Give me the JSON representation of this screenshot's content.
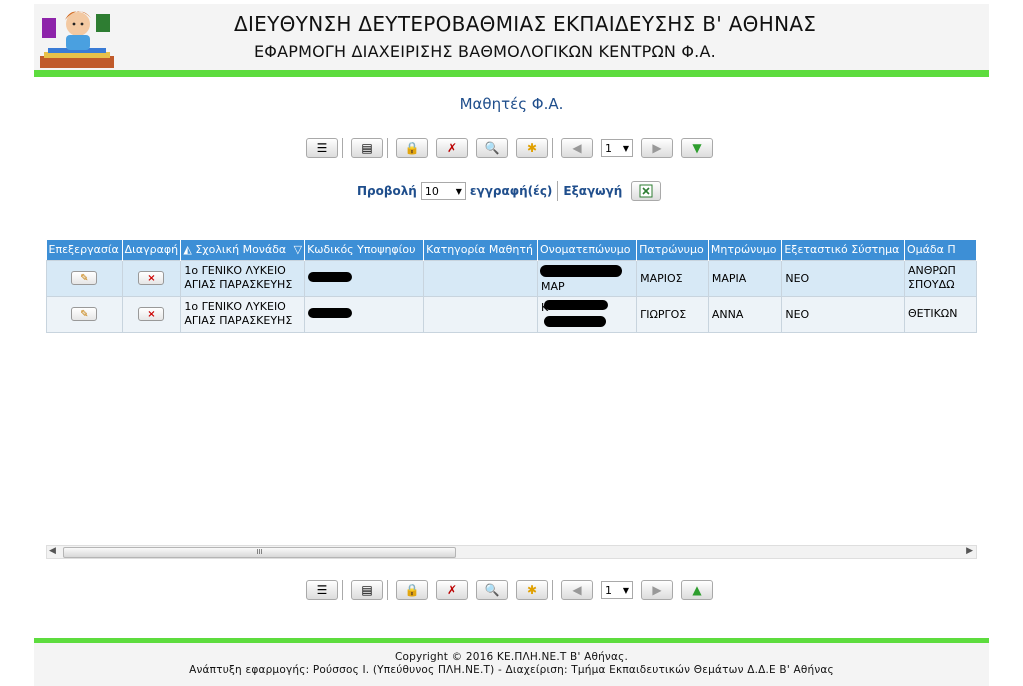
{
  "header": {
    "title_line1": "ΔΙΕΥΘΥΝΣΗ ΔΕΥΤΕΡΟΒΑΘΜΙΑΣ ΕΚΠΑΙΔΕΥΣΗΣ Β' ΑΘΗΝΑΣ",
    "title_line2": "ΕΦΑΡΜΟΓΗ ΔΙΑΧΕΙΡΙΣΗΣ ΒΑΘΜΟΛΟΓΙΚΩΝ ΚΕΝΤΡΩΝ Φ.Α."
  },
  "page_title": "Μαθητές Φ.Α.",
  "pager": {
    "page": "1"
  },
  "view": {
    "label": "Προβολή",
    "page_size": "10",
    "suffix": "εγγραφή(ές)",
    "export_label": "Εξαγωγή"
  },
  "grid": {
    "columns": [
      "Επεξεργασία",
      "Διαγραφή",
      "Σχολική Μονάδα",
      "Κωδικός Υποψηφίου",
      "Κατηγορία Μαθητή",
      "Ονοματεπώνυμο",
      "Πατρώνυμο",
      "Μητρώνυμο",
      "Εξεταστικό Σύστημα",
      "Ομάδα Π"
    ],
    "rows": [
      {
        "school": "1ο ΓΕΝΙΚΟ ΛΥΚΕΙΟ ΑΓΙΑΣ ΠΑΡΑΣΚΕΥΗΣ",
        "name_visible": "ΜΑΡ",
        "father": "ΜΑΡΙΟΣ",
        "mother": "ΜΑΡΙΑ",
        "system": "ΝΕΟ",
        "group": "ΑΝΘΡΩΠ ΣΠΟΥΔΩ"
      },
      {
        "school": "1ο ΓΕΝΙΚΟ ΛΥΚΕΙΟ ΑΓΙΑΣ ΠΑΡΑΣΚΕΥΗΣ",
        "name_visible": "Κ",
        "father": "ΓΙΩΡΓΟΣ",
        "mother": "ΑΝΝΑ",
        "system": "ΝΕΟ",
        "group": "ΘΕΤΙΚΩΝ"
      }
    ]
  },
  "scrollbar": {
    "grip": "III"
  },
  "footer": {
    "copyright": "Copyright © 2016 ΚΕ.ΠΛΗ.ΝΕ.Τ Β' Αθήνας.",
    "credits": "Ανάπτυξη εφαρμογής: Ρούσσος Ι. (Υπεύθυνος ΠΛΗ.ΝΕ.Τ) - Διαχείριση: Τμήμα Εκπαιδευτικών Θεμάτων Δ.Δ.Ε Β' Αθήνας"
  },
  "colors": {
    "green_bar": "#5ddc3e",
    "grid_header": "#3d8fd6",
    "title_blue": "#1f4e8c",
    "row_alt1": "#d7e9f6",
    "row_alt2": "#edf3f8"
  }
}
